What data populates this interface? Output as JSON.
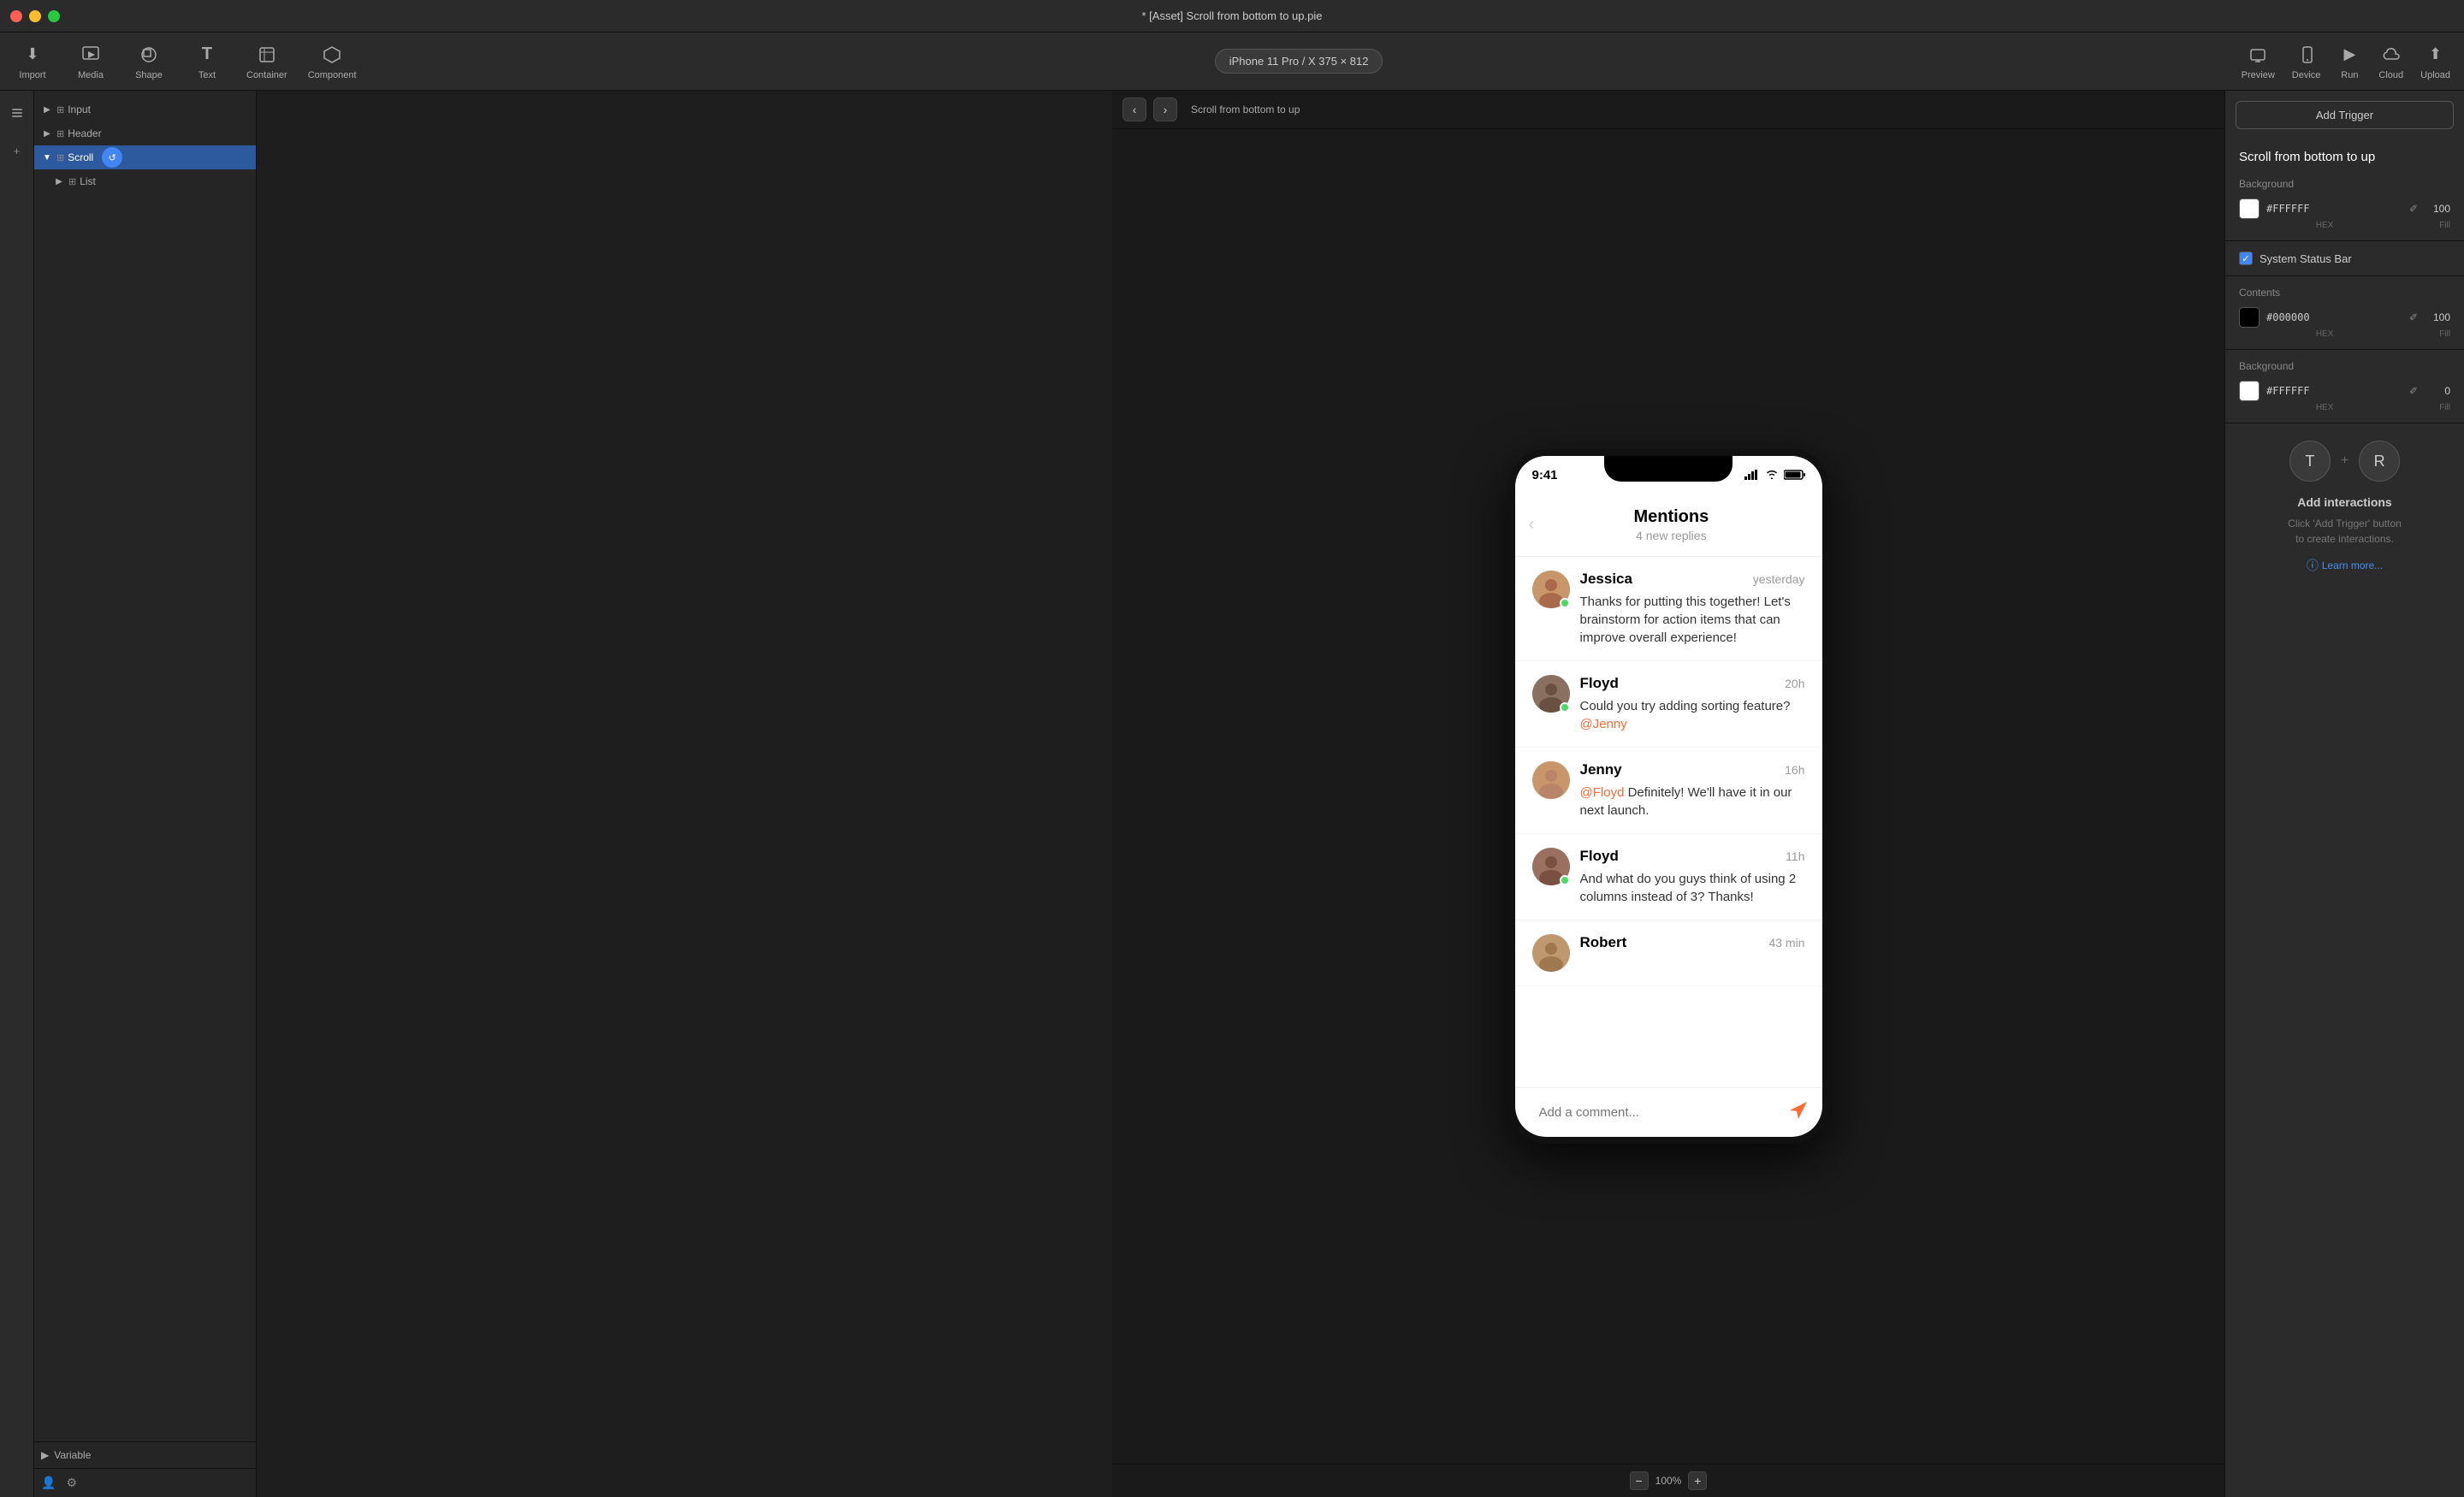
{
  "titleBar": {
    "title": "* [Asset] Scroll from bottom to up.pie"
  },
  "toolbar": {
    "import_label": "Import",
    "media_label": "Media",
    "shape_label": "Shape",
    "text_label": "Text",
    "container_label": "Container",
    "component_label": "Component",
    "device_label": "iPhone 11 Pro / X  375 × 812",
    "preview_label": "Preview",
    "device_tab_label": "Device",
    "run_label": "Run",
    "cloud_label": "Cloud",
    "upload_label": "Upload"
  },
  "sidebar": {
    "layers": [
      {
        "id": "input",
        "label": "Input",
        "indent": 0,
        "hasArrow": true,
        "expanded": false
      },
      {
        "id": "header",
        "label": "Header",
        "indent": 0,
        "hasArrow": true,
        "expanded": false
      },
      {
        "id": "scroll",
        "label": "Scroll",
        "indent": 0,
        "hasArrow": true,
        "expanded": true,
        "active": true
      },
      {
        "id": "list",
        "label": "List",
        "indent": 1,
        "hasArrow": true,
        "expanded": false
      }
    ],
    "variable_label": "Variable"
  },
  "canvas": {
    "breadcrumb": "Scroll from bottom to up",
    "zoom": "100%"
  },
  "phone": {
    "time": "9:41",
    "title": "Mentions",
    "subtitle": "4 new replies",
    "messages": [
      {
        "id": "jessica",
        "name": "Jessica",
        "time": "yesterday",
        "text": "Thanks for putting this together! Let's brainstorm for action items that can improve overall experience!",
        "avatarClass": "avatar-jessica",
        "hasDot": true
      },
      {
        "id": "floyd1",
        "name": "Floyd",
        "time": "20h",
        "text": "Could you try adding sorting feature?",
        "mention": "@Jenny",
        "avatarClass": "avatar-floyd",
        "hasDot": true
      },
      {
        "id": "jenny",
        "name": "Jenny",
        "time": "16h",
        "textPre": "",
        "mention": "@Floyd",
        "textPost": " Definitely! We'll have it in our next launch.",
        "avatarClass": "avatar-jenny",
        "hasDot": false
      },
      {
        "id": "floyd2",
        "name": "Floyd",
        "time": "11h",
        "text": "And what do you guys think of using 2 columns instead of 3? Thanks!",
        "avatarClass": "avatar-floyd2",
        "hasDot": true
      },
      {
        "id": "robert",
        "name": "Robert",
        "time": "43 min",
        "avatarClass": "avatar-robert",
        "hasDot": false
      }
    ],
    "comment_placeholder": "Add a comment..."
  },
  "rightPanel": {
    "add_trigger_label": "Add Trigger",
    "panel_title": "Scroll from bottom to up",
    "background_section": {
      "title": "Background",
      "color": "#FFFFFF",
      "hex": "#FFFFFF",
      "fill": "100",
      "hex_label": "HEX",
      "fill_label": "Fill"
    },
    "system_status_bar": {
      "title": "System Status Bar",
      "checked": true
    },
    "contents_section": {
      "title": "Contents",
      "color": "#000000",
      "hex": "#000000",
      "fill": "100",
      "hex_label": "HEX",
      "fill_label": "Fill"
    },
    "background2_section": {
      "title": "Background",
      "color": "#FFFFFF",
      "hex": "#FFFFFF",
      "fill": "0",
      "hex_label": "HEX",
      "fill_label": "Fill"
    },
    "interactions": {
      "title": "Add interactions",
      "desc_line1": "Click 'Add Trigger' button",
      "desc_line2": "to create interactions.",
      "learn_more": "Learn more..."
    }
  }
}
